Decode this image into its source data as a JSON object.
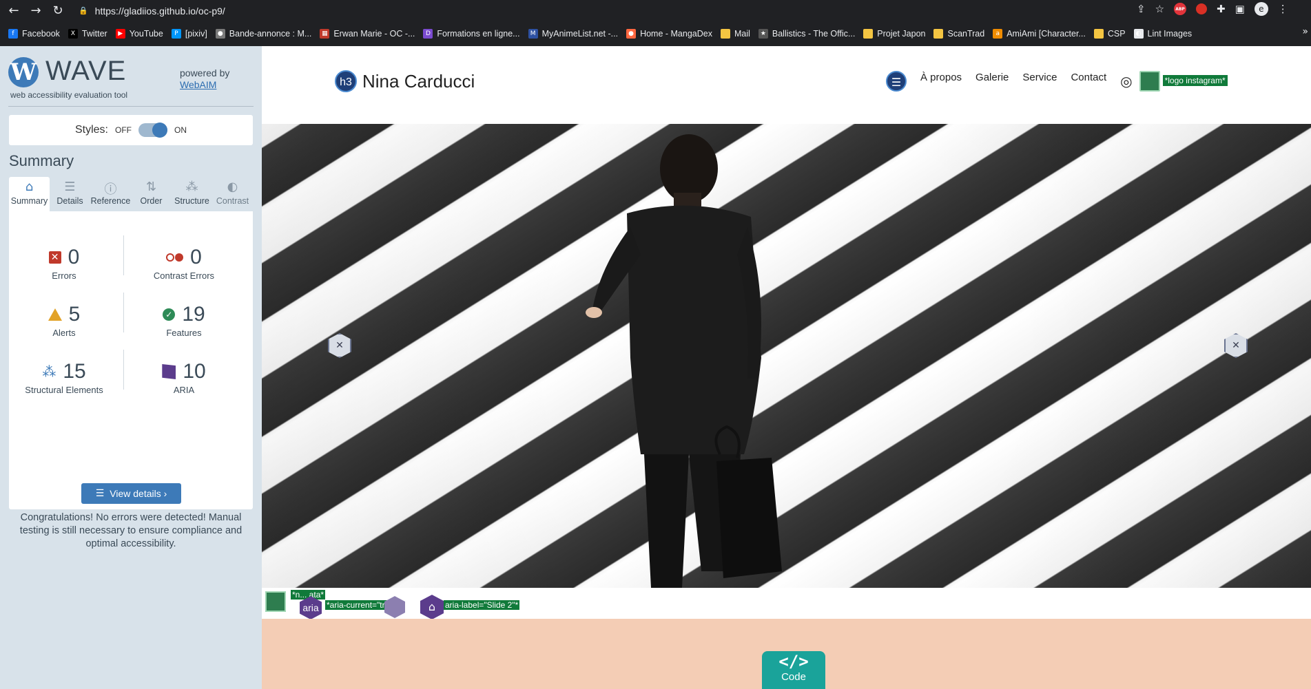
{
  "browser": {
    "url": "https://gladiios.github.io/oc-p9/",
    "bookmarks": [
      {
        "label": "Facebook",
        "color": "#1877f2",
        "glyph": "f"
      },
      {
        "label": "Twitter",
        "color": "#000000",
        "glyph": "X"
      },
      {
        "label": "YouTube",
        "color": "#ff0000",
        "glyph": "▶"
      },
      {
        "label": "[pixiv]",
        "color": "#0096fa",
        "glyph": "P"
      },
      {
        "label": "Bande-annonce : M...",
        "color": "#7a7a7a",
        "glyph": "●"
      },
      {
        "label": "Erwan Marie - OC -...",
        "color": "#c0392b",
        "glyph": "▦"
      },
      {
        "label": "Formations en ligne...",
        "color": "#7b4bd0",
        "glyph": "D"
      },
      {
        "label": "MyAnimeList.net -...",
        "color": "#2e51a2",
        "glyph": "M"
      },
      {
        "label": "Home - MangaDex",
        "color": "#ff6740",
        "glyph": "●"
      },
      {
        "label": "Mail",
        "color": "#f4c542",
        "glyph": ""
      },
      {
        "label": "Ballistics - The Offic...",
        "color": "#555555",
        "glyph": "★"
      },
      {
        "label": "Projet Japon",
        "color": "#f4c542",
        "glyph": ""
      },
      {
        "label": "ScanTrad",
        "color": "#f4c542",
        "glyph": ""
      },
      {
        "label": "AmiAmi [Character...",
        "color": "#f08c00",
        "glyph": "a"
      },
      {
        "label": "CSP",
        "color": "#f4c542",
        "glyph": ""
      },
      {
        "label": "Lint Images",
        "color": "#e8eaed",
        "glyph": "◐"
      }
    ]
  },
  "wave": {
    "logo_letter": "W",
    "logo_text": "WAVE",
    "tagline": "web accessibility evaluation tool",
    "powered_by": "powered by",
    "webaim": "WebAIM",
    "styles_label": "Styles:",
    "off": "OFF",
    "on": "ON",
    "summary_title": "Summary",
    "tabs": [
      {
        "label": "Summary",
        "icon": "⌂"
      },
      {
        "label": "Details",
        "icon": "☰"
      },
      {
        "label": "Reference",
        "icon": "ⓘ"
      },
      {
        "label": "Order",
        "icon": "⇅"
      },
      {
        "label": "Structure",
        "icon": "⁂"
      },
      {
        "label": "Contrast",
        "icon": "◐"
      }
    ],
    "stats": {
      "errors": {
        "value": "0",
        "label": "Errors"
      },
      "contrast": {
        "value": "0",
        "label": "Contrast Errors"
      },
      "alerts": {
        "value": "5",
        "label": "Alerts"
      },
      "features": {
        "value": "19",
        "label": "Features"
      },
      "structural": {
        "value": "15",
        "label": "Structural Elements"
      },
      "aria": {
        "value": "10",
        "label": "ARIA"
      }
    },
    "view_details": "View details ›",
    "congrats": "Congratulations! No errors were detected! Manual testing is still necessary to ensure compliance and optimal accessibility."
  },
  "site": {
    "h3_badge": "h3",
    "title": "Nina Carducci",
    "nav": [
      "À propos",
      "Galerie",
      "Service",
      "Contact"
    ],
    "instagram_alt": "*logo instagram*",
    "annotations": {
      "img_alt": "*n... ata*",
      "aria_badge": "aria",
      "aria_current": "*aria-current=\"true\"*",
      "aria_label": "aria-label=\"Slide 2\"*"
    },
    "code_label": "Code",
    "code_glyph": "</>"
  }
}
